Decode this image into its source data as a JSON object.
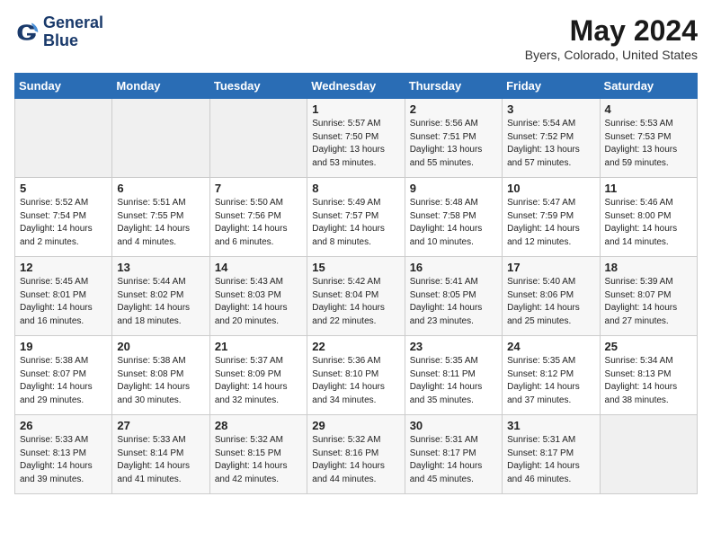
{
  "header": {
    "logo_line1": "General",
    "logo_line2": "Blue",
    "month_year": "May 2024",
    "location": "Byers, Colorado, United States"
  },
  "days_of_week": [
    "Sunday",
    "Monday",
    "Tuesday",
    "Wednesday",
    "Thursday",
    "Friday",
    "Saturday"
  ],
  "weeks": [
    [
      {
        "day": "",
        "empty": true
      },
      {
        "day": "",
        "empty": true
      },
      {
        "day": "",
        "empty": true
      },
      {
        "day": "1",
        "sunrise": "5:57 AM",
        "sunset": "7:50 PM",
        "daylight": "13 hours and 53 minutes."
      },
      {
        "day": "2",
        "sunrise": "5:56 AM",
        "sunset": "7:51 PM",
        "daylight": "13 hours and 55 minutes."
      },
      {
        "day": "3",
        "sunrise": "5:54 AM",
        "sunset": "7:52 PM",
        "daylight": "13 hours and 57 minutes."
      },
      {
        "day": "4",
        "sunrise": "5:53 AM",
        "sunset": "7:53 PM",
        "daylight": "13 hours and 59 minutes."
      }
    ],
    [
      {
        "day": "5",
        "sunrise": "5:52 AM",
        "sunset": "7:54 PM",
        "daylight": "14 hours and 2 minutes."
      },
      {
        "day": "6",
        "sunrise": "5:51 AM",
        "sunset": "7:55 PM",
        "daylight": "14 hours and 4 minutes."
      },
      {
        "day": "7",
        "sunrise": "5:50 AM",
        "sunset": "7:56 PM",
        "daylight": "14 hours and 6 minutes."
      },
      {
        "day": "8",
        "sunrise": "5:49 AM",
        "sunset": "7:57 PM",
        "daylight": "14 hours and 8 minutes."
      },
      {
        "day": "9",
        "sunrise": "5:48 AM",
        "sunset": "7:58 PM",
        "daylight": "14 hours and 10 minutes."
      },
      {
        "day": "10",
        "sunrise": "5:47 AM",
        "sunset": "7:59 PM",
        "daylight": "14 hours and 12 minutes."
      },
      {
        "day": "11",
        "sunrise": "5:46 AM",
        "sunset": "8:00 PM",
        "daylight": "14 hours and 14 minutes."
      }
    ],
    [
      {
        "day": "12",
        "sunrise": "5:45 AM",
        "sunset": "8:01 PM",
        "daylight": "14 hours and 16 minutes."
      },
      {
        "day": "13",
        "sunrise": "5:44 AM",
        "sunset": "8:02 PM",
        "daylight": "14 hours and 18 minutes."
      },
      {
        "day": "14",
        "sunrise": "5:43 AM",
        "sunset": "8:03 PM",
        "daylight": "14 hours and 20 minutes."
      },
      {
        "day": "15",
        "sunrise": "5:42 AM",
        "sunset": "8:04 PM",
        "daylight": "14 hours and 22 minutes."
      },
      {
        "day": "16",
        "sunrise": "5:41 AM",
        "sunset": "8:05 PM",
        "daylight": "14 hours and 23 minutes."
      },
      {
        "day": "17",
        "sunrise": "5:40 AM",
        "sunset": "8:06 PM",
        "daylight": "14 hours and 25 minutes."
      },
      {
        "day": "18",
        "sunrise": "5:39 AM",
        "sunset": "8:07 PM",
        "daylight": "14 hours and 27 minutes."
      }
    ],
    [
      {
        "day": "19",
        "sunrise": "5:38 AM",
        "sunset": "8:07 PM",
        "daylight": "14 hours and 29 minutes."
      },
      {
        "day": "20",
        "sunrise": "5:38 AM",
        "sunset": "8:08 PM",
        "daylight": "14 hours and 30 minutes."
      },
      {
        "day": "21",
        "sunrise": "5:37 AM",
        "sunset": "8:09 PM",
        "daylight": "14 hours and 32 minutes."
      },
      {
        "day": "22",
        "sunrise": "5:36 AM",
        "sunset": "8:10 PM",
        "daylight": "14 hours and 34 minutes."
      },
      {
        "day": "23",
        "sunrise": "5:35 AM",
        "sunset": "8:11 PM",
        "daylight": "14 hours and 35 minutes."
      },
      {
        "day": "24",
        "sunrise": "5:35 AM",
        "sunset": "8:12 PM",
        "daylight": "14 hours and 37 minutes."
      },
      {
        "day": "25",
        "sunrise": "5:34 AM",
        "sunset": "8:13 PM",
        "daylight": "14 hours and 38 minutes."
      }
    ],
    [
      {
        "day": "26",
        "sunrise": "5:33 AM",
        "sunset": "8:13 PM",
        "daylight": "14 hours and 39 minutes."
      },
      {
        "day": "27",
        "sunrise": "5:33 AM",
        "sunset": "8:14 PM",
        "daylight": "14 hours and 41 minutes."
      },
      {
        "day": "28",
        "sunrise": "5:32 AM",
        "sunset": "8:15 PM",
        "daylight": "14 hours and 42 minutes."
      },
      {
        "day": "29",
        "sunrise": "5:32 AM",
        "sunset": "8:16 PM",
        "daylight": "14 hours and 44 minutes."
      },
      {
        "day": "30",
        "sunrise": "5:31 AM",
        "sunset": "8:17 PM",
        "daylight": "14 hours and 45 minutes."
      },
      {
        "day": "31",
        "sunrise": "5:31 AM",
        "sunset": "8:17 PM",
        "daylight": "14 hours and 46 minutes."
      },
      {
        "day": "",
        "empty": true
      }
    ]
  ]
}
